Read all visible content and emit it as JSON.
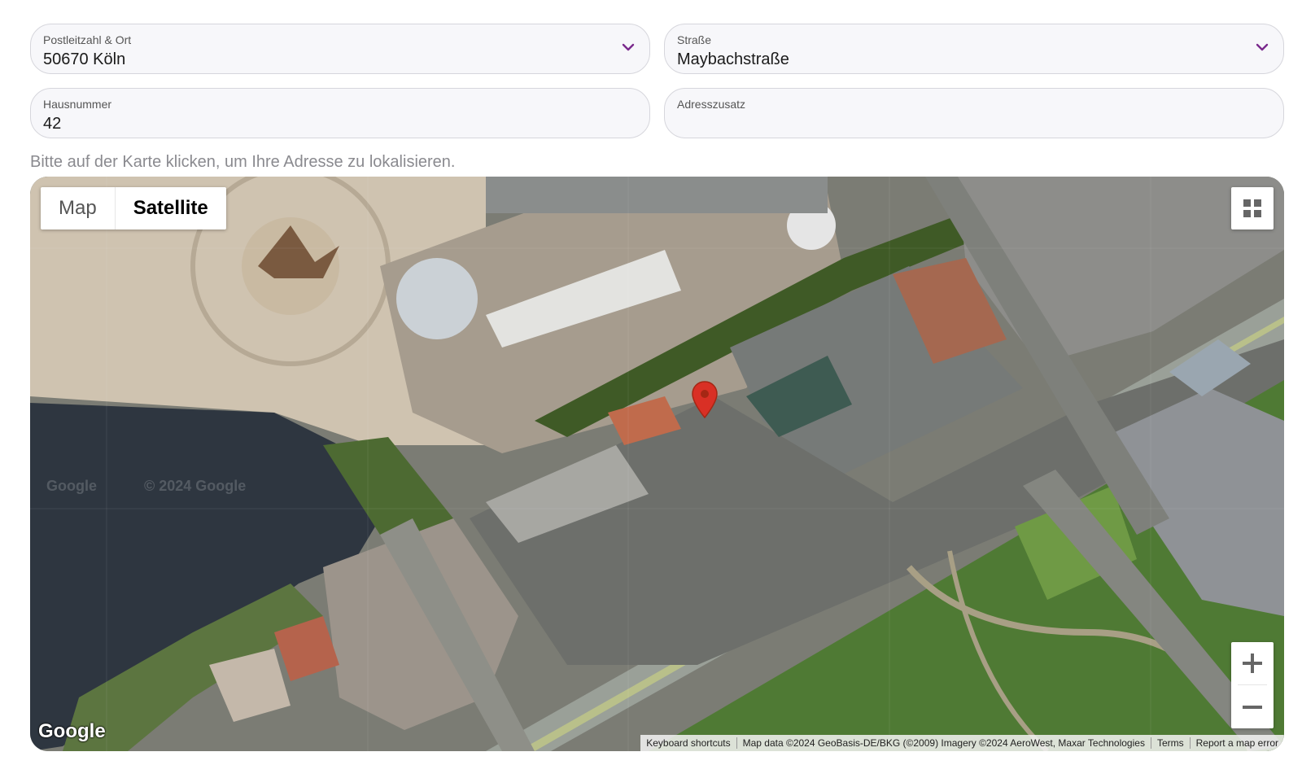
{
  "form": {
    "postal": {
      "label": "Postleitzahl & Ort",
      "value": "50670 Köln"
    },
    "street": {
      "label": "Straße",
      "value": "Maybachstraße"
    },
    "house_number": {
      "label": "Hausnummer",
      "value": "42"
    },
    "address_extra": {
      "label": "Adresszusatz",
      "value": ""
    },
    "hint": "Bitte auf der Karte klicken, um Ihre Adresse zu lokalisieren.",
    "accent_color": "#7a2a8c"
  },
  "map": {
    "type_options": [
      "Map",
      "Satellite"
    ],
    "active_type": "Satellite",
    "logo": "Google",
    "watermark_left": "Google",
    "watermark_right": "© 2024 Google",
    "attribution": {
      "keyboard": "Keyboard shortcuts",
      "data": "Map data ©2024 GeoBasis-DE/BKG (©2009) Imagery ©2024 AeroWest, Maxar Technologies",
      "terms": "Terms",
      "report": "Report a map error"
    },
    "icons": {
      "fullscreen": "grid-fullscreen-icon",
      "zoom_in": "plus-icon",
      "zoom_out": "minus-icon",
      "marker": "map-pin-icon",
      "dropdown": "chevron-down-icon"
    },
    "marker_color": "#d93025"
  }
}
